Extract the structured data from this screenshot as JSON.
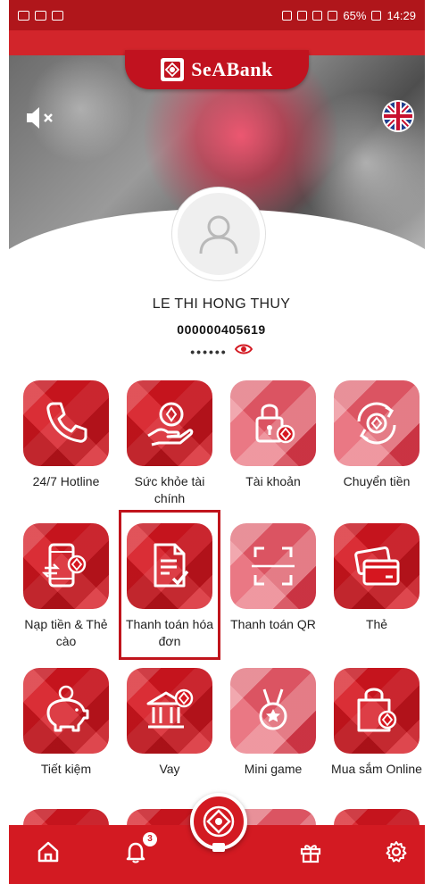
{
  "status_bar": {
    "battery": "65%",
    "time": "14:29"
  },
  "header": {
    "brand_name": "SeABank",
    "brand_color": "#c1121f",
    "mute_icon": "speaker-mute-icon",
    "language_icon": "uk-flag-icon"
  },
  "profile": {
    "name": "LE THI HONG THUY",
    "account_number": "000000405619",
    "balance_mask": "••••••",
    "visibility_icon": "eye-icon"
  },
  "menu": {
    "items": [
      {
        "label": "24/7 Hotline",
        "icon": "phone-icon"
      },
      {
        "label": "Sức khỏe tài chính",
        "icon": "hand-coin-icon"
      },
      {
        "label": "Tài khoản",
        "icon": "lock-account-icon"
      },
      {
        "label": "Chuyển tiền",
        "icon": "transfer-coin-icon"
      },
      {
        "label": "Nạp tiền & Thẻ cào",
        "icon": "phone-topup-icon"
      },
      {
        "label": "Thanh toán hóa đơn",
        "icon": "bill-check-icon"
      },
      {
        "label": "Thanh toán QR",
        "icon": "qr-scan-icon"
      },
      {
        "label": "Thẻ",
        "icon": "card-icon"
      },
      {
        "label": "Tiết kiệm",
        "icon": "piggy-bank-icon"
      },
      {
        "label": "Vay",
        "icon": "bank-loan-icon"
      },
      {
        "label": "Mini game",
        "icon": "medal-icon"
      },
      {
        "label": "Mua sắm Online",
        "icon": "shopping-bag-icon"
      }
    ]
  },
  "bottom_nav": {
    "notification_count": "3",
    "accent": "#d31a22"
  }
}
